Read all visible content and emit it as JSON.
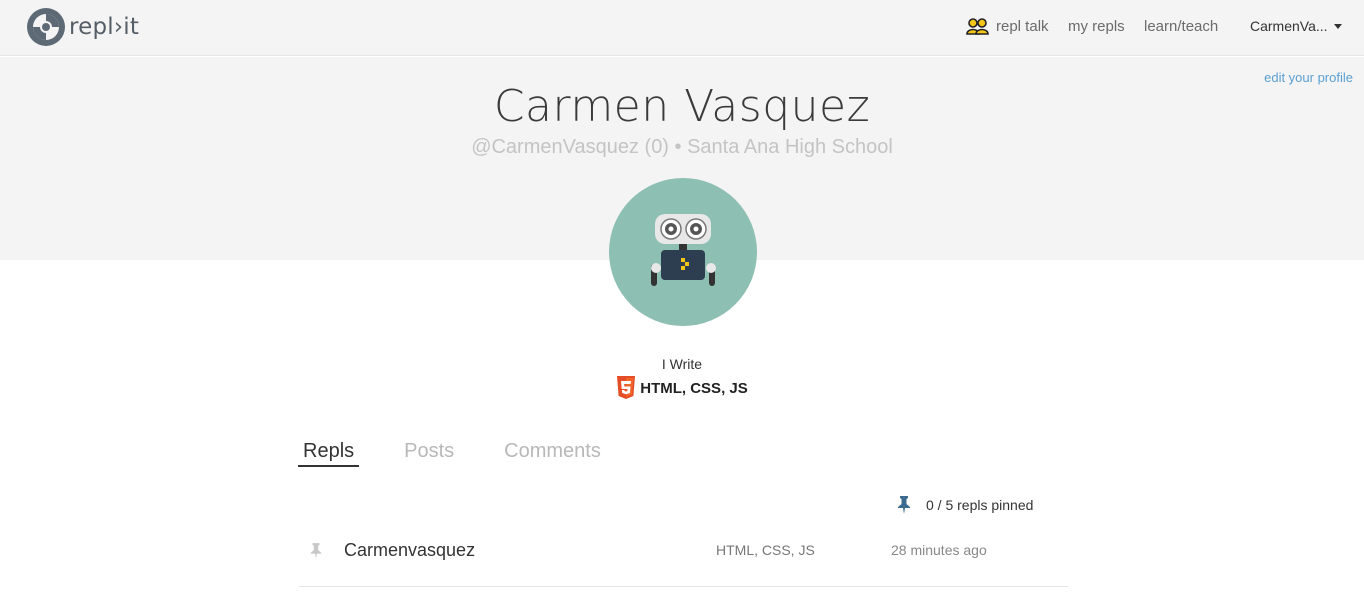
{
  "nav": {
    "logo_text": "repl›it",
    "items": [
      {
        "label": "repl talk",
        "icon": "users-icon"
      },
      {
        "label": "my repls"
      },
      {
        "label": "learn/teach"
      }
    ],
    "user": "CarmenVa..."
  },
  "hero": {
    "edit_label": "edit your profile",
    "name": "Carmen Vasquez",
    "subtitle": "@CarmenVasquez (0) • Santa Ana High School"
  },
  "profile": {
    "i_write": "I Write",
    "languages": "HTML, CSS, JS",
    "language_icon": "html5-icon"
  },
  "tabs": [
    "Repls",
    "Posts",
    "Comments"
  ],
  "active_tab": "Repls",
  "pinned": {
    "label": "0 / 5 repls pinned"
  },
  "repls": [
    {
      "name": "Carmenvasquez",
      "language": "HTML, CSS, JS",
      "time": "28 minutes ago"
    }
  ],
  "colors": {
    "accent_link": "#5a9fd4",
    "avatar_bg": "#8dbfb2",
    "html5": "#e44d26",
    "pin_blue": "#3b6b8f"
  }
}
